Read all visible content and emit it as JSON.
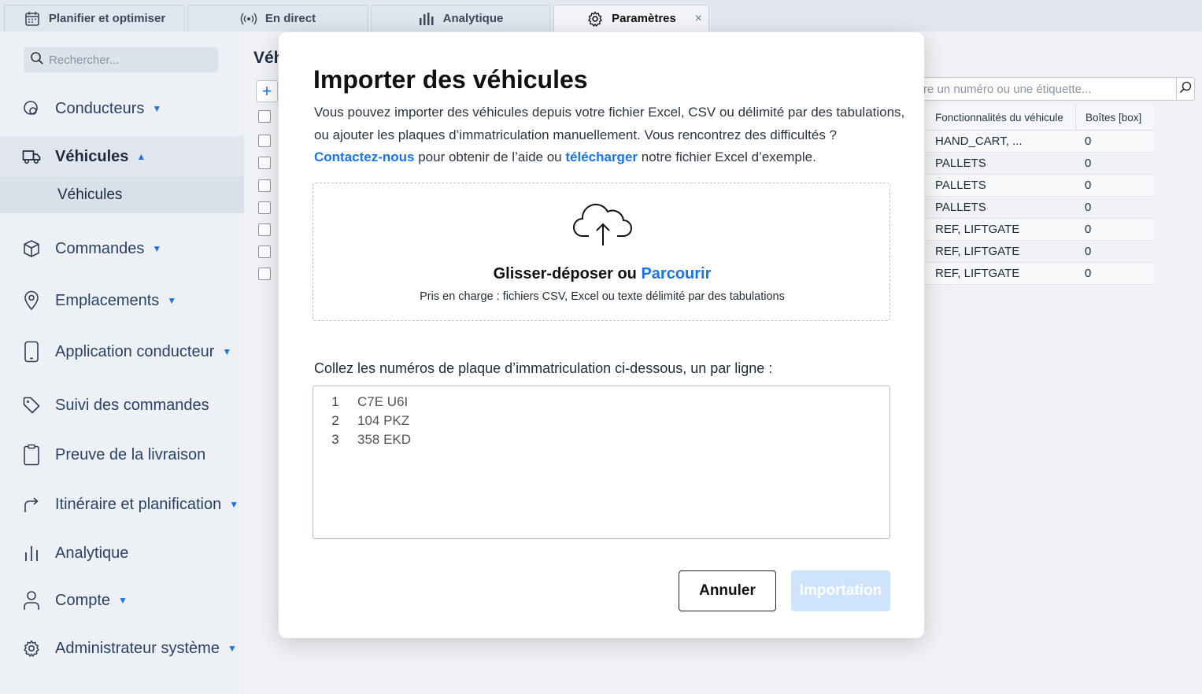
{
  "tabs": [
    {
      "label": "Planifier et optimiser",
      "icon": "calendar-icon"
    },
    {
      "label": "En direct",
      "icon": "broadcast-icon"
    },
    {
      "label": "Analytique",
      "icon": "bar-chart-icon"
    },
    {
      "label": "Paramètres",
      "icon": "gear-icon",
      "close": "×"
    }
  ],
  "sidebar": {
    "search_placeholder": "Rechercher...",
    "items": [
      {
        "label": "Conducteurs",
        "icon": "steering-icon"
      },
      {
        "label": "Véhicules",
        "icon": "truck-icon"
      },
      {
        "label": "Commandes",
        "icon": "box-icon"
      },
      {
        "label": "Emplacements",
        "icon": "pin-icon"
      },
      {
        "label": "Application conducteur",
        "icon": "phone-icon"
      },
      {
        "label": "Suivi des commandes",
        "icon": "tag-icon"
      },
      {
        "label": "Preuve de la livraison",
        "icon": "clipboard-icon"
      },
      {
        "label": "Itinéraire et planification",
        "icon": "route-icon"
      },
      {
        "label": "Analytique",
        "icon": "bar-chart-icon"
      },
      {
        "label": "Compte",
        "icon": "user-icon"
      },
      {
        "label": "Administrateur système",
        "icon": "gear-icon"
      }
    ],
    "sub_item": "Véhicules"
  },
  "main": {
    "title": "Véh",
    "add_label": "+",
    "search_placeholder": "re un numéro ou une étiquette...",
    "table": {
      "headers": [
        "Fonctionnalités du véhicule",
        "Boîtes [box]"
      ],
      "rows": [
        [
          "HAND_CART, ...",
          "0"
        ],
        [
          "PALLETS",
          "0"
        ],
        [
          "PALLETS",
          "0"
        ],
        [
          "PALLETS",
          "0"
        ],
        [
          "REF, LIFTGATE",
          "0"
        ],
        [
          "REF, LIFTGATE",
          "0"
        ],
        [
          "REF, LIFTGATE",
          "0"
        ]
      ]
    }
  },
  "modal": {
    "title": "Importer des véhicules",
    "desc_line1": "Vous pouvez importer des véhicules depuis votre fichier Excel, CSV ou délimité par des tabulations,",
    "desc_line2": "ou ajouter les plaques d’immatriculation manuellement. Vous rencontrez des difficultés ?",
    "contact_link": "Contactez-nous",
    "desc_mid": " pour obtenir de l’aide ou ",
    "download_link": "télécharger",
    "desc_end": " notre fichier Excel d’exemple.",
    "drop_text": "Glisser-déposer ou ",
    "browse_link": "Parcourir",
    "supported": "Pris en charge : fichiers CSV, Excel ou texte délimité par des tabulations",
    "paste_label": "Collez les numéros de plaque d’immatriculation ci-dessous, un par ligne :",
    "plates": [
      {
        "n": "1",
        "value": "C7E U6I"
      },
      {
        "n": "2",
        "value": "104 PKZ"
      },
      {
        "n": "3",
        "value": "358 EKD"
      }
    ],
    "cancel_label": "Annuler",
    "import_label": "Importation"
  }
}
